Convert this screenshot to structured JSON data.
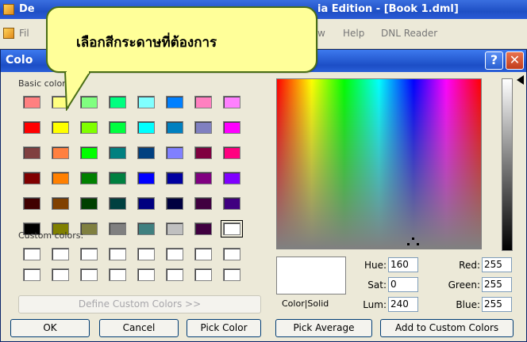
{
  "app": {
    "title_left": "De",
    "title_right": "ia Edition - [Book 1.dml]",
    "menu": [
      "Fil",
      "w",
      "Help",
      "DNL Reader"
    ]
  },
  "dialog": {
    "title": "Colo",
    "help_label": "?",
    "close_label": "✕",
    "basic_label": "Basic colors:",
    "custom_label": "Custom colors:",
    "basic_colors": [
      [
        "#ff8080",
        "#ffff80",
        "#80ff80",
        "#00ff80",
        "#80ffff",
        "#0080ff",
        "#ff80c0",
        "#ff80ff"
      ],
      [
        "#ff0000",
        "#ffff00",
        "#80ff00",
        "#00ff40",
        "#00ffff",
        "#0080c0",
        "#8080c0",
        "#ff00ff"
      ],
      [
        "#804040",
        "#ff8040",
        "#00ff00",
        "#008080",
        "#004080",
        "#8080ff",
        "#800040",
        "#ff0080"
      ],
      [
        "#800000",
        "#ff8000",
        "#008000",
        "#008040",
        "#0000ff",
        "#0000a0",
        "#800080",
        "#8000ff"
      ],
      [
        "#400000",
        "#804000",
        "#004000",
        "#004040",
        "#000080",
        "#000040",
        "#400040",
        "#400080"
      ],
      [
        "#000000",
        "#808000",
        "#808040",
        "#808080",
        "#408080",
        "#c0c0c0",
        "#400040",
        "#ffffff"
      ]
    ],
    "custom_rows": 2,
    "custom_cols": 8,
    "define_button": "Define Custom Colors >>",
    "ok_button": "OK",
    "cancel_button": "Cancel",
    "pick_color_button": "Pick Color",
    "pick_average_button": "Pick Average",
    "add_custom_button": "Add to Custom Colors",
    "preview_label": "Color|Solid",
    "hue_label": "Hue:",
    "hue_value": "160",
    "sat_label": "Sat:",
    "sat_value": "0",
    "lum_label": "Lum:",
    "lum_value": "240",
    "red_label": "Red:",
    "red_value": "255",
    "green_label": "Green:",
    "green_value": "255",
    "blue_label": "Blue:",
    "blue_value": "255"
  },
  "callout": {
    "text": "เลือกสีกระดาษที่ต้องการ",
    "fill": "#ffff99",
    "border": "#4a6e16"
  }
}
